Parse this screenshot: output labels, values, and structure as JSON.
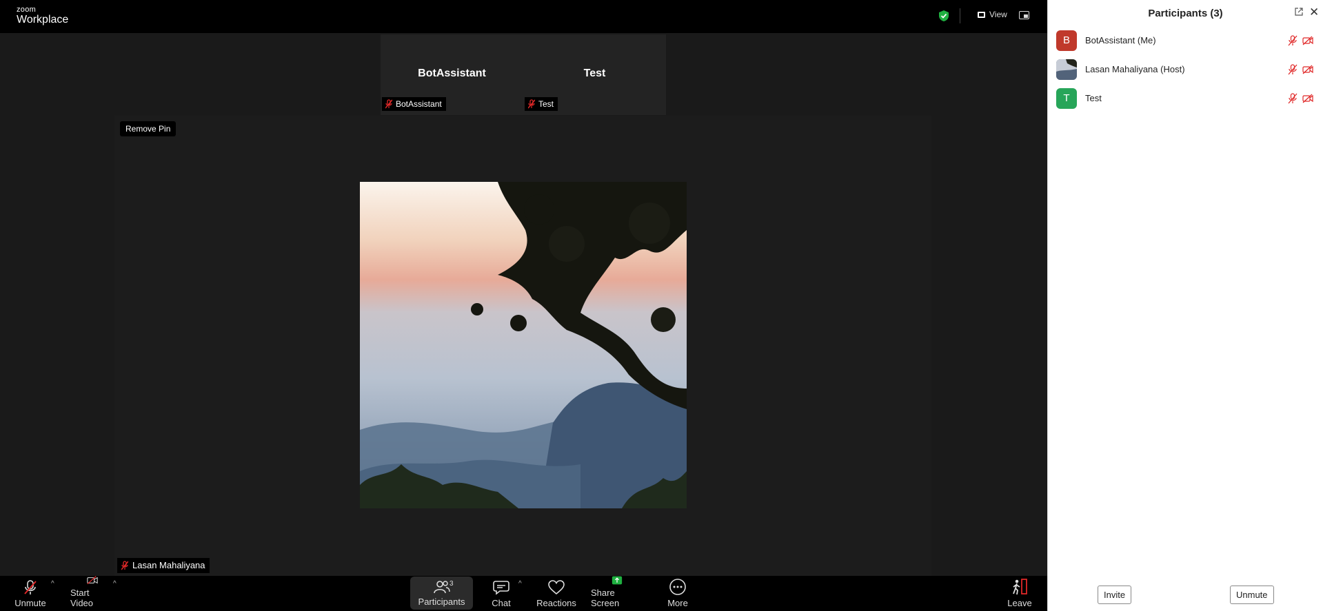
{
  "app": {
    "logo_small": "zoom",
    "logo_big": "Workplace"
  },
  "topbar": {
    "view_label": "View",
    "shield_color": "#1fb141"
  },
  "gallery": {
    "tiles": [
      {
        "name": "BotAssistant",
        "tag": "BotAssistant"
      },
      {
        "name": "Test",
        "tag": "Test"
      }
    ]
  },
  "pinned": {
    "remove_pin_label": "Remove Pin",
    "participant_name": "Lasan Mahaliyana"
  },
  "toolbar": {
    "unmute_label": "Unmute",
    "start_video_label": "Start Video",
    "participants_label": "Participants",
    "participants_count": "3",
    "chat_label": "Chat",
    "reactions_label": "Reactions",
    "share_screen_label": "Share Screen",
    "more_label": "More",
    "leave_label": "Leave",
    "caret": "^",
    "share_color": "#1fb141",
    "muted_color": "#e02828"
  },
  "panel": {
    "title": "Participants (3)",
    "close_glyph": "✕",
    "participants": [
      {
        "name": "BotAssistant (Me)",
        "initial": "B",
        "avatar_color": "#c0392b"
      },
      {
        "name": "Lasan Mahaliyana (Host)",
        "initial": "",
        "avatar_color": "#4a5a6e"
      },
      {
        "name": "Test",
        "initial": "T",
        "avatar_color": "#27a559"
      }
    ],
    "invite_label": "Invite",
    "unmute_label": "Unmute"
  }
}
